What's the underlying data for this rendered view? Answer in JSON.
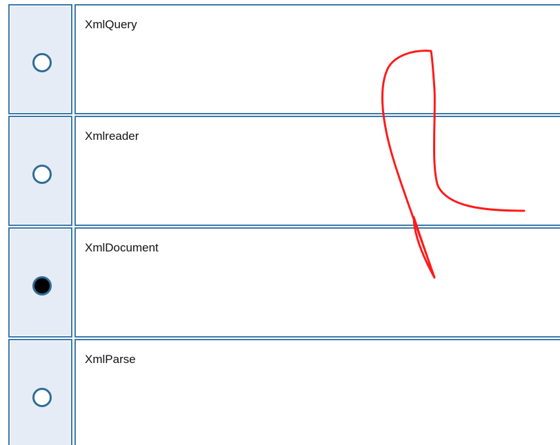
{
  "options": [
    {
      "label": "XmlQuery",
      "selected": false
    },
    {
      "label": "Xmlreader",
      "selected": false
    },
    {
      "label": "XmlDocument",
      "selected": true
    },
    {
      "label": "XmlParse",
      "selected": false
    }
  ],
  "colors": {
    "border": "#3b78a8",
    "radio_cell_bg": "#e6ecf5",
    "annotation_stroke": "#ff1a1a"
  }
}
